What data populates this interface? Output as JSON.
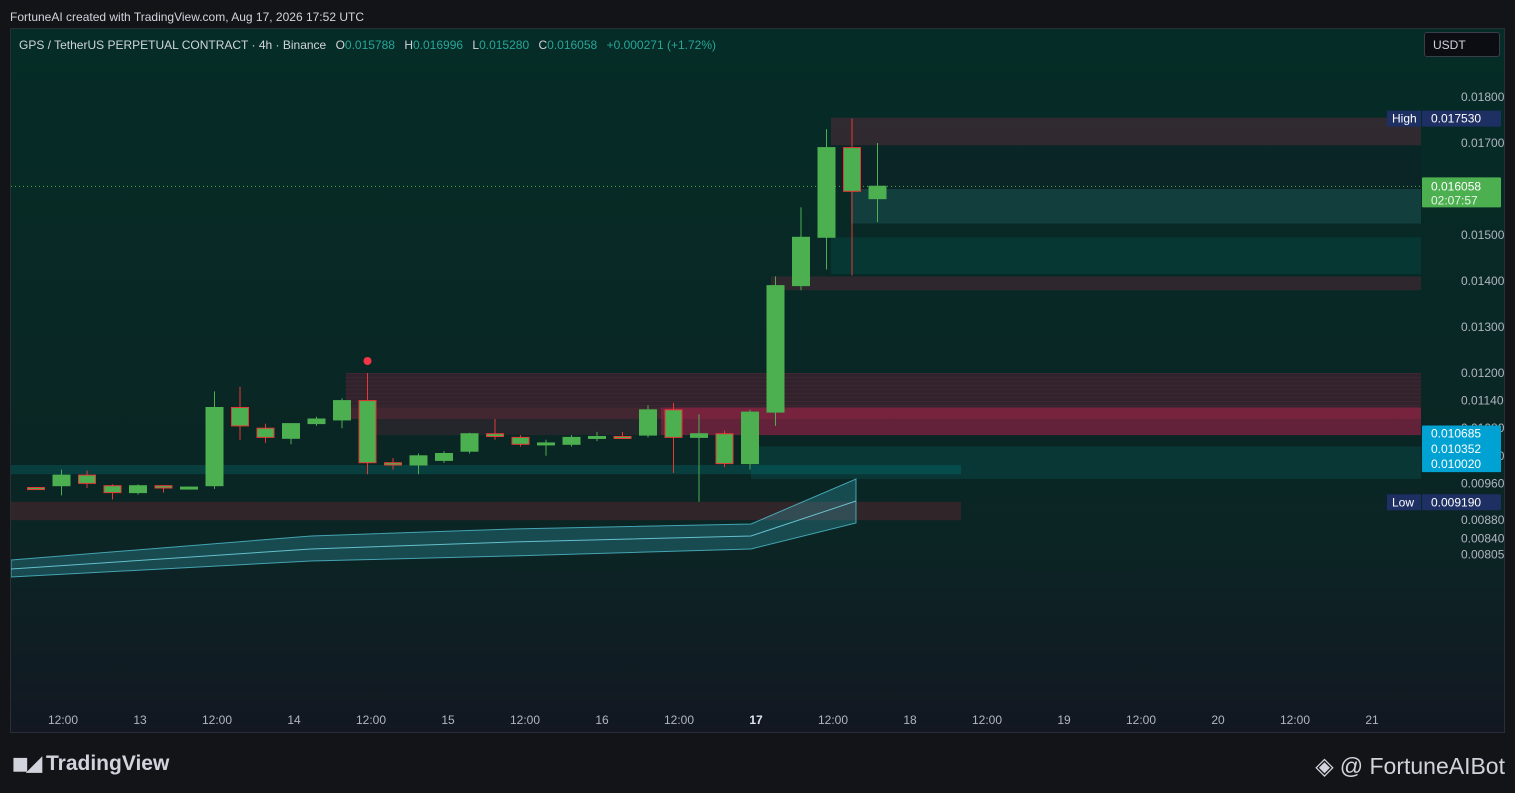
{
  "credit": "FortuneAI created with TradingView.com, Aug 17, 2026 17:52 UTC",
  "legend": {
    "symbol": "GPS / TetherUS PERPETUAL CONTRACT · 4h · Binance",
    "o_label": "O",
    "o": "0.015788",
    "h_label": "H",
    "h": "0.016996",
    "l_label": "L",
    "l": "0.015280",
    "c_label": "C",
    "c": "0.016058",
    "change": "+0.000271 (+1.72%)"
  },
  "unit": "USDT",
  "footer": {
    "logo": "TradingView",
    "handle": "@ FortuneAIBot"
  },
  "colors": {
    "up": "#4caf50",
    "down_outline": "#e53935",
    "price_tag": "#4caf50",
    "blue_tag": "#0097c7",
    "hilo_tag": "#1a2a55"
  },
  "chart_data": {
    "type": "candlestick",
    "interval": "4h",
    "y_ticks": [
      "0.018000",
      "0.017000",
      "0.015000",
      "0.014000",
      "0.013000",
      "0.012000",
      "0.011400",
      "0.010800",
      "0.010200",
      "0.009600",
      "0.008800",
      "0.008400",
      "0.008050"
    ],
    "x_ticks": [
      "12:00",
      "13",
      "12:00",
      "14",
      "12:00",
      "15",
      "12:00",
      "16",
      "12:00",
      "17",
      "12:00",
      "18",
      "12:00",
      "19",
      "12:00",
      "20",
      "12:00",
      "21"
    ],
    "price_labels": [
      {
        "label": "High",
        "value": "0.017530",
        "style": "hilo"
      },
      {
        "label": "",
        "value": "0.016058",
        "sub": "02:07:57",
        "style": "last"
      },
      {
        "label": "",
        "value": "0.010685",
        "style": "blue"
      },
      {
        "label": "",
        "value": "0.010352",
        "style": "blue"
      },
      {
        "label": "",
        "value": "0.010020",
        "style": "blue"
      },
      {
        "label": "Low",
        "value": "0.009190",
        "style": "hilo"
      }
    ],
    "candles": [
      {
        "o": 0.00951,
        "h": 0.00952,
        "l": 0.00946,
        "c": 0.0095
      },
      {
        "o": 0.00955,
        "h": 0.0099,
        "l": 0.00934,
        "c": 0.00978
      },
      {
        "o": 0.00978,
        "h": 0.00988,
        "l": 0.0095,
        "c": 0.0096
      },
      {
        "o": 0.00955,
        "h": 0.00958,
        "l": 0.00925,
        "c": 0.0094
      },
      {
        "o": 0.0094,
        "h": 0.00958,
        "l": 0.00936,
        "c": 0.00955
      },
      {
        "o": 0.00955,
        "h": 0.00956,
        "l": 0.0094,
        "c": 0.0095
      },
      {
        "o": 0.0095,
        "h": 0.00953,
        "l": 0.00947,
        "c": 0.00952
      },
      {
        "o": 0.00955,
        "h": 0.0116,
        "l": 0.00948,
        "c": 0.01125
      },
      {
        "o": 0.01125,
        "h": 0.0117,
        "l": 0.01055,
        "c": 0.01085
      },
      {
        "o": 0.0108,
        "h": 0.0109,
        "l": 0.01048,
        "c": 0.0106
      },
      {
        "o": 0.01058,
        "h": 0.0109,
        "l": 0.01045,
        "c": 0.0109
      },
      {
        "o": 0.0109,
        "h": 0.01105,
        "l": 0.01085,
        "c": 0.011
      },
      {
        "o": 0.01098,
        "h": 0.01145,
        "l": 0.0108,
        "c": 0.0114
      },
      {
        "o": 0.0114,
        "h": 0.012,
        "l": 0.0098,
        "c": 0.01005
      },
      {
        "o": 0.01005,
        "h": 0.01015,
        "l": 0.0099,
        "c": 0.01
      },
      {
        "o": 0.01,
        "h": 0.01025,
        "l": 0.0098,
        "c": 0.0102
      },
      {
        "o": 0.0101,
        "h": 0.0103,
        "l": 0.01005,
        "c": 0.01025
      },
      {
        "o": 0.0103,
        "h": 0.0107,
        "l": 0.01025,
        "c": 0.01068
      },
      {
        "o": 0.01068,
        "h": 0.011,
        "l": 0.01055,
        "c": 0.01062
      },
      {
        "o": 0.0106,
        "h": 0.01065,
        "l": 0.0104,
        "c": 0.01045
      },
      {
        "o": 0.01045,
        "h": 0.01055,
        "l": 0.0102,
        "c": 0.01048
      },
      {
        "o": 0.01045,
        "h": 0.01065,
        "l": 0.0104,
        "c": 0.0106
      },
      {
        "o": 0.01058,
        "h": 0.01072,
        "l": 0.01052,
        "c": 0.01062
      },
      {
        "o": 0.01062,
        "h": 0.01072,
        "l": 0.01058,
        "c": 0.0106
      },
      {
        "o": 0.01065,
        "h": 0.0113,
        "l": 0.0106,
        "c": 0.0112
      },
      {
        "o": 0.0112,
        "h": 0.01135,
        "l": 0.00983,
        "c": 0.0106
      },
      {
        "o": 0.0106,
        "h": 0.0111,
        "l": 0.0092,
        "c": 0.01068
      },
      {
        "o": 0.01068,
        "h": 0.01075,
        "l": 0.00995,
        "c": 0.01003
      },
      {
        "o": 0.01003,
        "h": 0.0112,
        "l": 0.0099,
        "c": 0.01115
      },
      {
        "o": 0.01115,
        "h": 0.0141,
        "l": 0.01085,
        "c": 0.0139
      },
      {
        "o": 0.0139,
        "h": 0.0156,
        "l": 0.0138,
        "c": 0.01495
      },
      {
        "o": 0.01495,
        "h": 0.0173,
        "l": 0.01425,
        "c": 0.0169
      },
      {
        "o": 0.0169,
        "h": 0.01753,
        "l": 0.01412,
        "c": 0.01595
      },
      {
        "o": 0.01579,
        "h": 0.017,
        "l": 0.01528,
        "c": 0.01606
      }
    ]
  }
}
